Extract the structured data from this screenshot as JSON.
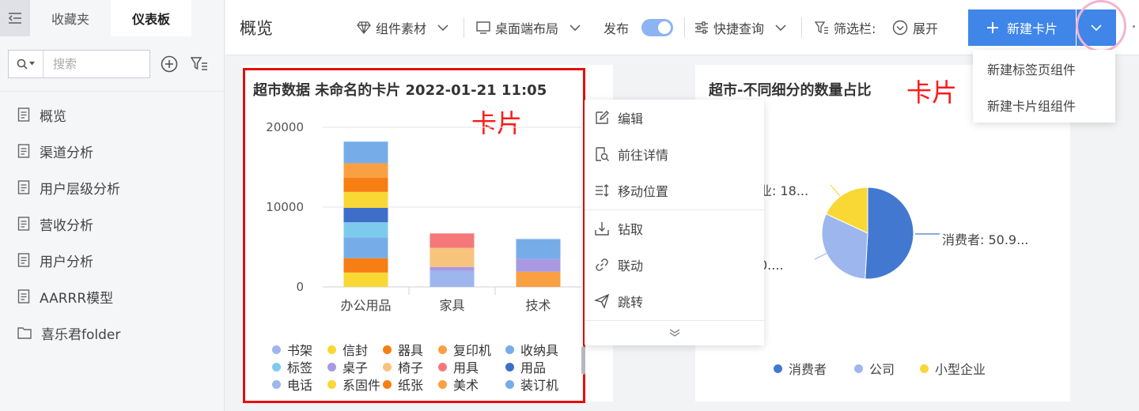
{
  "sidebar": {
    "tabs": [
      {
        "label": "收藏夹"
      },
      {
        "label": "仪表板"
      }
    ],
    "search_placeholder": "搜索",
    "items": [
      {
        "label": "概览",
        "icon": "document-icon"
      },
      {
        "label": "渠道分析",
        "icon": "document-icon"
      },
      {
        "label": "用户层级分析",
        "icon": "document-icon"
      },
      {
        "label": "营收分析",
        "icon": "document-icon"
      },
      {
        "label": "用户分析",
        "icon": "document-icon"
      },
      {
        "label": "AARRR模型",
        "icon": "document-icon"
      },
      {
        "label": "喜乐君folder",
        "icon": "folder-icon"
      }
    ]
  },
  "toolbar": {
    "page_title": "概览",
    "component_material": "组件素材",
    "desktop_layout": "桌面端布局",
    "publish": "发布",
    "publish_on": true,
    "quick_query": "快捷查询",
    "filter_bar": "筛选栏:",
    "expand": "展开",
    "new_card": "新建卡片"
  },
  "dropdown": {
    "items": [
      "新建标签页组件",
      "新建卡片组组件"
    ]
  },
  "context_menu": {
    "items": [
      "编辑",
      "前往详情",
      "移动位置",
      "钻取",
      "联动",
      "跳转"
    ]
  },
  "annotations": {
    "card_note_1": "卡片",
    "card_note_2": "卡片"
  },
  "colors": {
    "accent": "#3f86e8",
    "annotation_red": "#e80d0d"
  },
  "card1": {
    "title": "超市数据 未命名的卡片 2022-01-21 11:05"
  },
  "card2": {
    "title": "超市-不同细分的数量占比",
    "labels": {
      "right": "消费者: 50.9...",
      "top_left": "业: 18...",
      "left": "0...."
    }
  },
  "chart_data": [
    {
      "type": "bar",
      "stacked": true,
      "categories": [
        "办公用品",
        "家具",
        "技术"
      ],
      "yticks": [
        0,
        10000,
        20000
      ],
      "ylim": [
        0,
        20000
      ],
      "grid": true,
      "legend_position": "bottom",
      "series": [
        {
          "name": "书架",
          "color": "#9db6ee",
          "values": [
            0,
            2000,
            0
          ]
        },
        {
          "name": "信封",
          "color": "#f9d835",
          "values": [
            1800,
            0,
            0
          ]
        },
        {
          "name": "器具",
          "color": "#f77e12",
          "values": [
            1800,
            0,
            0
          ]
        },
        {
          "name": "复印机",
          "color": "#f9a043",
          "values": [
            0,
            0,
            1900
          ]
        },
        {
          "name": "收纳具",
          "color": "#76ade9",
          "values": [
            2600,
            0,
            0
          ]
        },
        {
          "name": "标签",
          "color": "#7dcbec",
          "values": [
            1900,
            0,
            0
          ]
        },
        {
          "name": "桌子",
          "color": "#a899e2",
          "values": [
            0,
            500,
            1600
          ]
        },
        {
          "name": "椅子",
          "color": "#f8c37d",
          "values": [
            0,
            2400,
            0
          ]
        },
        {
          "name": "用具",
          "color": "#f4787a",
          "values": [
            0,
            1800,
            0
          ]
        },
        {
          "name": "用品",
          "color": "#3d6ec9",
          "values": [
            1800,
            0,
            0
          ]
        },
        {
          "name": "电话",
          "color": "#9db6ee",
          "values": [
            0,
            0,
            0
          ]
        },
        {
          "name": "系固件",
          "color": "#f9d835",
          "values": [
            2000,
            0,
            0
          ]
        },
        {
          "name": "纸张",
          "color": "#f77e12",
          "values": [
            1800,
            0,
            0
          ]
        },
        {
          "name": "美术",
          "color": "#f9a043",
          "values": [
            1800,
            0,
            0
          ]
        },
        {
          "name": "装订机",
          "color": "#76ade9",
          "values": [
            2700,
            0,
            2500
          ]
        }
      ]
    },
    {
      "type": "pie",
      "legend_position": "bottom",
      "slices": [
        {
          "name": "消费者",
          "value": 50.9,
          "color": "#4378d1"
        },
        {
          "name": "公司",
          "value": 31.0,
          "color": "#9db6ee"
        },
        {
          "name": "小型企业",
          "value": 18.1,
          "color": "#f9d835"
        }
      ]
    }
  ]
}
